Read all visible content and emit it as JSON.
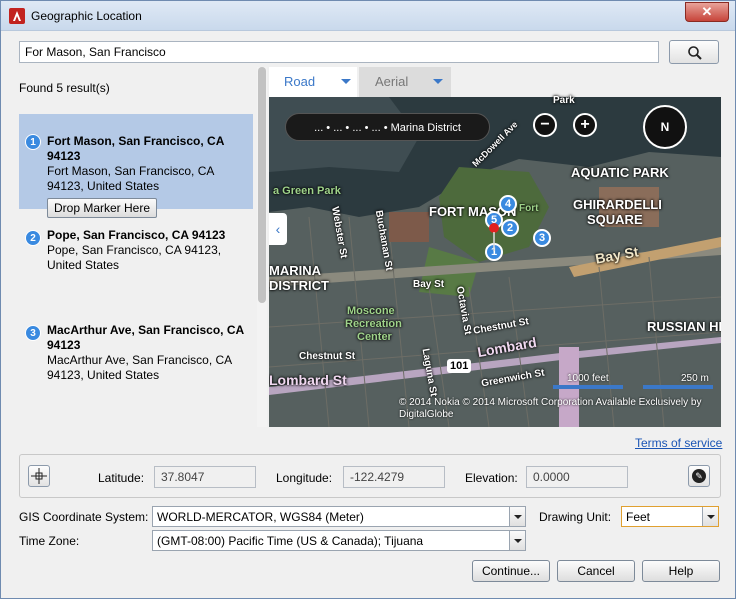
{
  "window": {
    "title": "Geographic Location",
    "close_label": "✕"
  },
  "search": {
    "value": "For Mason, San Francisco"
  },
  "results": {
    "found_label": "Found 5 result(s)",
    "items": [
      {
        "num": "1",
        "title": "Fort Mason, San Francisco, CA 94123",
        "address": "Fort Mason, San Francisco, CA 94123, United States",
        "action": "Drop Marker Here"
      },
      {
        "num": "2",
        "title": "Pope, San Francisco, CA 94123",
        "address": "Pope, San Francisco, CA 94123, United States"
      },
      {
        "num": "3",
        "title": "MacArthur Ave, San Francisco, CA 94123",
        "address": "MacArthur Ave, San Francisco, CA 94123, United States"
      }
    ]
  },
  "map": {
    "tabs": {
      "road": "Road",
      "aerial": "Aerial"
    },
    "breadcrumb": "... • ... • ... • ... • Marina District",
    "zoom_out": "−",
    "zoom_in": "+",
    "compass": "N",
    "labels": {
      "aquatic_park": "AQUATIC PARK",
      "fort_mason": "FORT MASON",
      "ghirardelli_1": "GHIRARDELLI",
      "ghirardelli_2": "SQUARE",
      "marina_1": "MARINA",
      "marina_2": "DISTRICT",
      "russian_hill": "RUSSIAN HIL",
      "bay_st": "Bay St",
      "bay_st2": "Bay St",
      "lombard": "Lombard St",
      "lombard2": "Lombard",
      "chestnut": "Chestnut St",
      "chestnut2": "Chestnut St",
      "greenwich": "Greenwich St",
      "moscone_1": "Moscone",
      "moscone_2": "Recreation",
      "moscone_3": "Center",
      "route_101": "101",
      "mcdowell": "McDowell Ave",
      "laguna": "Laguna St",
      "octavia": "Octavia St",
      "buchanan": "Buchanan St",
      "webster": "Webster St",
      "park": "Park",
      "green_park": "a Green Park",
      "fort_small": "Fort"
    },
    "markers": [
      "1",
      "2",
      "3",
      "4",
      "5"
    ],
    "scale_feet": "1000 feet",
    "scale_m": "250 m",
    "copyright": "© 2014 Nokia   © 2014 Microsoft Corporation   Available Exclusively by DigitalGlobe"
  },
  "terms_link": "Terms of service",
  "coords": {
    "latitude_label": "Latitude:",
    "latitude_value": "37.8047",
    "longitude_label": "Longitude:",
    "longitude_value": "-122.4279",
    "elevation_label": "Elevation:",
    "elevation_value": "0.0000"
  },
  "settings": {
    "gis_label": "GIS Coordinate System:",
    "gis_value": "WORLD-MERCATOR, WGS84 (Meter)",
    "unit_label": "Drawing Unit:",
    "unit_value": "Feet",
    "tz_label": "Time Zone:",
    "tz_value": "(GMT-08:00) Pacific Time (US & Canada); Tijuana"
  },
  "buttons": {
    "continue": "Continue...",
    "cancel": "Cancel",
    "help": "Help"
  },
  "colors": {
    "accent": "#3b78c8",
    "selection": "#b4c9e6",
    "marker": "#3a8ae0",
    "link": "#1a55b5"
  }
}
